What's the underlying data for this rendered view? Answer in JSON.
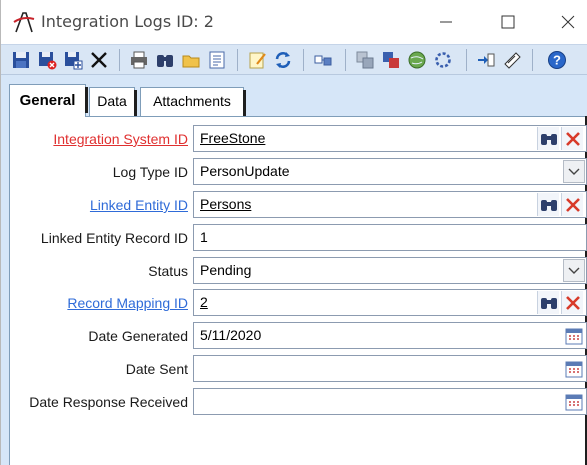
{
  "window": {
    "title": "Integration Logs ID: 2"
  },
  "toolbar": {
    "icons": [
      "save-icon",
      "save-close-icon",
      "save-new-icon",
      "delete-icon",
      "print-icon",
      "find-icon",
      "open-folder-icon",
      "list-icon",
      "notes-icon",
      "refresh-icon",
      "link-icon",
      "copy-icon",
      "multi-window-icon",
      "globe-icon",
      "settings-cycle-icon",
      "import-icon",
      "attach-icon",
      "help-icon"
    ]
  },
  "tabs": [
    {
      "label": "General",
      "active": true
    },
    {
      "label": "Data",
      "active": false
    },
    {
      "label": "Attachments",
      "active": false
    }
  ],
  "form": {
    "integration_system_id": {
      "label": "Integration System ID",
      "value": "FreeStone"
    },
    "log_type_id": {
      "label": "Log Type ID",
      "value": "PersonUpdate"
    },
    "linked_entity_id": {
      "label": "Linked Entity ID",
      "value": "Persons"
    },
    "linked_entity_record_id": {
      "label": "Linked Entity Record ID",
      "value": "1"
    },
    "status": {
      "label": "Status",
      "value": "Pending"
    },
    "record_mapping_id": {
      "label": "Record Mapping ID",
      "value": "2"
    },
    "date_generated": {
      "label": "Date Generated",
      "value": "5/11/2020"
    },
    "date_sent": {
      "label": "Date Sent",
      "value": ""
    },
    "date_response_received": {
      "label": "Date Response Received",
      "value": ""
    }
  },
  "colors": {
    "required_label": "#e03030",
    "link_label": "#2f6bd8",
    "toolbar_bg": "#d9e6f5",
    "content_bg": "#d6e6f8"
  }
}
